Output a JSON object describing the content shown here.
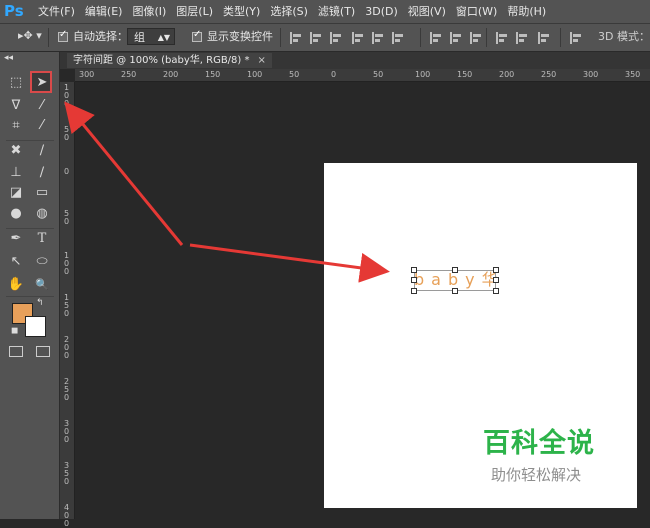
{
  "app": {
    "logo": "Ps"
  },
  "menu": [
    "文件(F)",
    "编辑(E)",
    "图像(I)",
    "图层(L)",
    "类型(Y)",
    "选择(S)",
    "滤镜(T)",
    "3D(D)",
    "视图(V)",
    "窗口(W)",
    "帮助(H)"
  ],
  "options": {
    "auto_select_label": "自动选择：",
    "auto_select_value": "组",
    "show_transform_label": "显示变换控件",
    "mode_label": "3D 模式："
  },
  "tab": {
    "title": "字符间距 @ 100% (baby华, RGB/8) *",
    "close": "×"
  },
  "ruler": {
    "top": [
      "300",
      "250",
      "200",
      "150",
      "100",
      "50",
      "0",
      "50",
      "100",
      "150",
      "200",
      "250",
      "300",
      "350"
    ],
    "left": [
      "1\n0\n0",
      "5\n0",
      "0",
      "5\n0",
      "1\n0\n0",
      "1\n5\n0",
      "2\n0\n0",
      "2\n5\n0",
      "3\n0\n0",
      "3\n5\n0",
      "4\n0\n0"
    ]
  },
  "canvas": {
    "text": "baby华",
    "text_color": "#e7a058"
  },
  "colors": {
    "foreground": "#e8a05a",
    "background": "#ffffff",
    "annotation": "#e53935",
    "accent": "#31a8ff"
  },
  "tools": [
    "marquee-icon",
    "move-icon",
    "lasso-icon",
    "quick-select-icon",
    "crop-icon",
    "eyedropper-icon",
    "healing-icon",
    "brush-icon",
    "stamp-icon",
    "history-brush-icon",
    "eraser-icon",
    "gradient-icon",
    "blur-icon",
    "dodge-icon",
    "pen-icon",
    "type-icon",
    "path-select-icon",
    "ellipse-icon",
    "hand-icon",
    "zoom-icon"
  ],
  "tool_glyphs": {
    "type": "T",
    "zoom": "🔍"
  },
  "watermark": {
    "title": "百科全说",
    "subtitle": "助你轻松解决"
  }
}
